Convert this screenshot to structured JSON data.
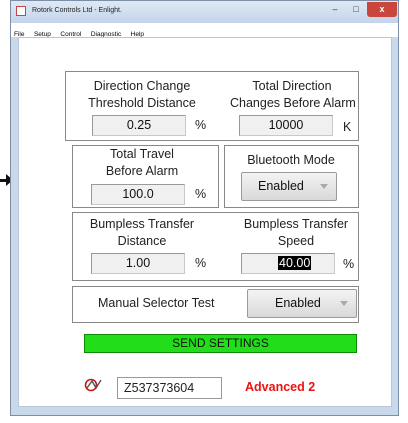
{
  "window": {
    "title": "Rotork Controls Ltd - Enlight.",
    "controls": {
      "minimize": "–",
      "maximize": "□",
      "close": "x"
    }
  },
  "menu": [
    "File",
    "Setup",
    "Control",
    "Diagnostic",
    "Help"
  ],
  "direction_change": {
    "label_line1": "Direction Change",
    "label_line2": "Threshold Distance",
    "value": "0.25",
    "unit": "%"
  },
  "total_direction": {
    "label_line1": "Total Direction",
    "label_line2": "Changes Before Alarm",
    "value": "10000",
    "unit": "K"
  },
  "total_travel": {
    "label_line1": "Total Travel",
    "label_line2": "Before Alarm",
    "value": "100.0",
    "unit": "%"
  },
  "bluetooth": {
    "label": "Bluetooth Mode",
    "selected": "Enabled"
  },
  "bumpless_distance": {
    "label_line1": "Bumpless Transfer",
    "label_line2": "Distance",
    "value": "1.00",
    "unit": "%"
  },
  "bumpless_speed": {
    "label_line1": "Bumpless Transfer",
    "label_line2": "Speed",
    "value": "40.00",
    "unit": "%"
  },
  "manual_selector": {
    "label": "Manual Selector Test",
    "selected": "Enabled"
  },
  "send_settings_label": "SEND SETTINGS",
  "footer": {
    "serial": "Z537373604",
    "level": "Advanced 2",
    "level_color": "#e11111",
    "logo_icon": "rotork-logo-icon"
  },
  "colors": {
    "send_button": "#22dd1a",
    "title_bar": "#c9d9ec"
  }
}
